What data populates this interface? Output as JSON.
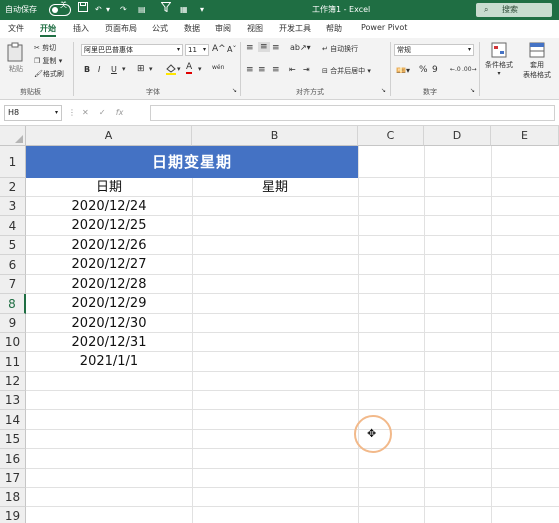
{
  "titlebar": {
    "autosave": "自动保存",
    "autosave_state": "关",
    "doc_title": "工作簿1 - Excel",
    "search": "搜索"
  },
  "tabs": [
    "文件",
    "开始",
    "插入",
    "页面布局",
    "公式",
    "数据",
    "审阅",
    "视图",
    "开发工具",
    "帮助",
    "Power Pivot"
  ],
  "active_tab": "开始",
  "ribbon": {
    "clipboard": {
      "paste": "粘贴",
      "cut": "剪切",
      "copy": "复制",
      "format_painter": "格式刷",
      "group": "剪贴板"
    },
    "font": {
      "font_name": "阿里巴巴普惠体",
      "font_size": "11",
      "bold": "B",
      "italic": "I",
      "underline": "U",
      "grow": "A",
      "shrink": "A",
      "font_color": "A",
      "phonetic": "wén",
      "group": "字体"
    },
    "alignment": {
      "wrap": "自动换行",
      "merge": "合并后居中",
      "group": "对齐方式"
    },
    "number": {
      "format": "常规",
      "percent": "%",
      "comma": "9",
      "group": "数字"
    },
    "styles": {
      "conditional": "条件格式",
      "table_format_1": "套用",
      "table_format_2": "表格格式"
    }
  },
  "formula_bar": {
    "name_box": "H8",
    "formula": ""
  },
  "sheet": {
    "columns": [
      "A",
      "B",
      "C",
      "D",
      "E"
    ],
    "rows": [
      "1",
      "2",
      "3",
      "4",
      "5",
      "6",
      "7",
      "8",
      "9",
      "10",
      "11",
      "12",
      "13",
      "14",
      "15",
      "16",
      "17",
      "18",
      "19"
    ],
    "title": "日期变星期",
    "header_date": "日期",
    "header_weekday": "星期",
    "dates": [
      "2020/12/24",
      "2020/12/25",
      "2020/12/26",
      "2020/12/27",
      "2020/12/28",
      "2020/12/29",
      "2020/12/30",
      "2020/12/31",
      "2021/1/1"
    ],
    "weekdays": [
      "",
      "",
      "",
      "",
      "",
      "",
      "",
      "",
      ""
    ]
  },
  "colors": {
    "excel_green": "#1f6e43",
    "title_fill": "#4472c4"
  }
}
